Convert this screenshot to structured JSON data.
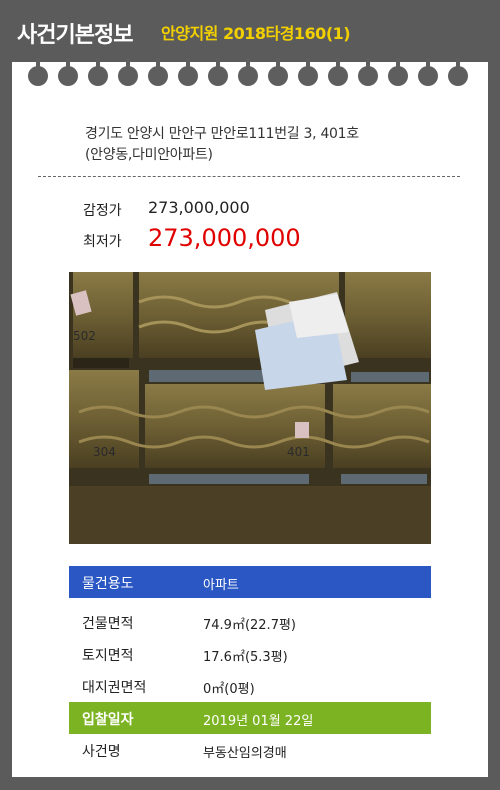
{
  "header": {
    "title": "사건기본정보",
    "case_number": "안양지원 2018타경160(1)"
  },
  "address": {
    "line1": "경기도 안양시 만안구 만안로111번길 3, 401호",
    "line2": "(안양동,다미안아파트)"
  },
  "price": {
    "appraisal_label": "감정가",
    "appraisal_value": "273,000,000",
    "minimum_label": "최저가",
    "minimum_value": "273,000,000"
  },
  "photo": {
    "labels": [
      "502",
      "304",
      "401"
    ]
  },
  "details": [
    {
      "label": "물건용도",
      "value": "아파트"
    },
    {
      "label": "건물면적",
      "value": "74.9㎡(22.7평)"
    },
    {
      "label": "토지면적",
      "value": "17.6㎡(5.3평)"
    },
    {
      "label": "대지권면적",
      "value": "0㎡(0평)"
    },
    {
      "label": "입찰일자",
      "value": "2019년 01월 22일"
    },
    {
      "label": "사건명",
      "value": "부동산임의경매"
    }
  ],
  "colors": {
    "accent_yellow": "#f2d000",
    "row_blue": "#2a57c3",
    "row_green": "#7cb322",
    "lowest_price_red": "#e00000"
  }
}
